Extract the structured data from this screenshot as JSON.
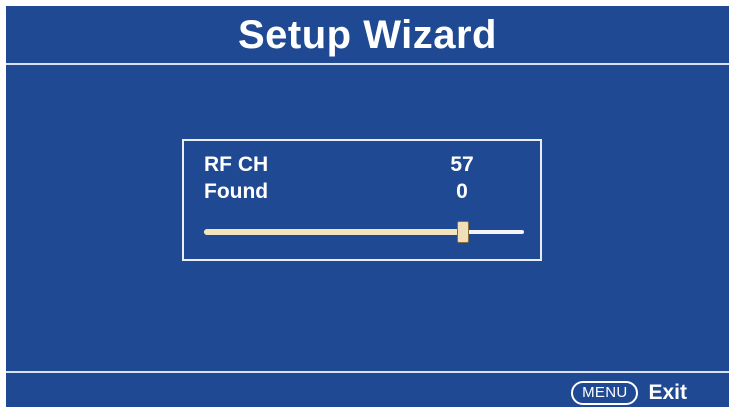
{
  "window": {
    "title": "Setup Wizard"
  },
  "scan": {
    "rf_ch_label": "RF CH",
    "rf_ch_value": "57",
    "found_label": "Found",
    "found_value": "0",
    "progress_fraction": 0.81
  },
  "footer": {
    "menu_key_label": "MENU",
    "exit_label": "Exit"
  },
  "colors": {
    "background": "#1f4a93",
    "text": "#ffffff",
    "progress_fill": "#f2e4bd",
    "track": "#f3f5fa"
  }
}
